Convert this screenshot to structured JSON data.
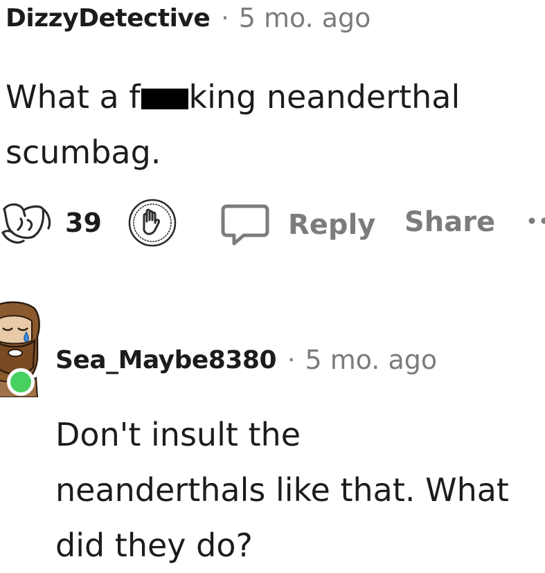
{
  "comment": {
    "username": "DizzyDetective",
    "separator": "·",
    "time": "5 mo. ago",
    "body": {
      "line1_before": "What a f",
      "line1_after": "king neanderthal",
      "line2": "scumbag."
    },
    "actions": {
      "upvote_count": "39",
      "reply_label": "Reply",
      "share_label": "Share"
    },
    "icons": {
      "award": "awarding-icon",
      "downvote": "raised-hand-icon",
      "reply": "speech-bubble-icon",
      "more": "more-dots-icon"
    }
  },
  "reply": {
    "username": "Sea_Maybe8380",
    "separator": "·",
    "time": "5 mo. ago",
    "body": {
      "line1": "Don't insult the",
      "line2": "neanderthals like that. What",
      "line3": "did they do?"
    },
    "online_status_color": "#46d160"
  },
  "colors": {
    "text": "#1c1c1c",
    "muted": "#7c7c7c",
    "online": "#46d160"
  }
}
